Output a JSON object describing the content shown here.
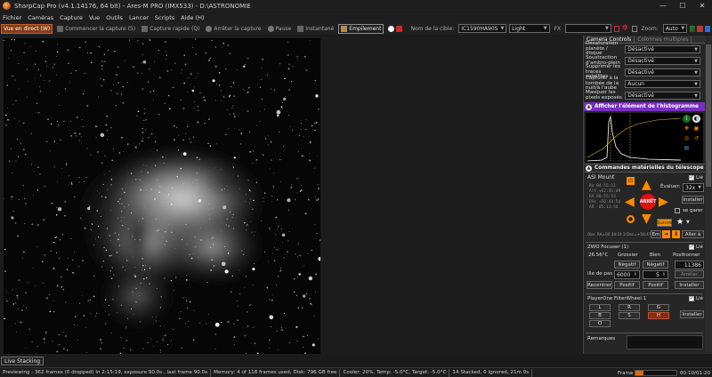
{
  "window": {
    "title": "SharpCap Pro (v4.1.14176, 64 bit) - Ares-M PRO (IMX533) - D:\\ASTRONOMIE",
    "minimize_icon": "minimize-icon",
    "maximize_icon": "maximize-icon",
    "close_icon": "close-icon"
  },
  "menu": [
    "Fichier",
    "Caméras",
    "Capture",
    "Vue",
    "Outils",
    "Lancer",
    "Scripts",
    "Aide (H)"
  ],
  "toolbar": {
    "live_view": "Vue en direct (W)",
    "start_capture": "Commencer la capture (5)",
    "quick_capture": "Capture rapide (Q)",
    "stop_capture": "Arrêter la capture",
    "pause": "Pause",
    "snapshot": "Instantané",
    "stacking": "Empilement",
    "target_label": "Nom de la cible:",
    "target_value": "IC1590HA90S",
    "filter_value": "Light",
    "fx_label": "FX",
    "fx_value": "",
    "zoom_label": "Zoom:",
    "zoom_value": "Auto"
  },
  "camera_controls": {
    "tab_active": "Camera Controls",
    "tab_inactive": "Colonnes multiples",
    "rows": [
      {
        "label": "Désaturation planète / disque",
        "value": "Désactivé"
      },
      {
        "label": "Soustraction d'ambro-plein",
        "value": "Désactivé"
      },
      {
        "label": "Supprimer les traces satellites",
        "value": "Désactivé"
      },
      {
        "label": "Capturer à la tombée de la nuit/à l'aube",
        "value": "Aucun"
      },
      {
        "label": "Masquer les pixels exposés",
        "value": "Désactivé"
      }
    ]
  },
  "histogram": {
    "header": "Afficher l'élément de l'histogramme"
  },
  "telescope": {
    "header": "Commandes matérielles du télescope",
    "mount_name": "ASI Mount",
    "enabled_label": "Lié",
    "rate_label": "Évaluer:",
    "rate_value": "32x",
    "install_label": "Installer",
    "stop_label": "ARRÊT",
    "park_label": "se garer",
    "follow_label": "Suivre",
    "goto_label": "Aller à",
    "em_label": "Em",
    "coords": [
      "Ra    04:55:11",
      "Alt   +62:41:09",
      "RA    00:55:53",
      "Déc  +56:44:54",
      "AR    -05:13:56"
    ],
    "sidereal": "Obs:  RA=00:34:24 2:Dec=+56:47:08"
  },
  "focuser": {
    "name": "ZWO Focuser (1)",
    "linked_label": "Lié",
    "temperature": "26.56°C",
    "coarse_label": "Grossier",
    "fine_label": "Bien",
    "position_label": "Positionner",
    "negative1": "Négatif",
    "negative2": "Négatif",
    "position_value": "11386",
    "step_label": "ille de pas",
    "step_coarse": "6000",
    "step_fine": "5",
    "stop_label": "Arrêter",
    "center_label": "Recentrer",
    "positive1": "Positif",
    "positive2": "Positif",
    "install_label": "Installer"
  },
  "filter_wheel": {
    "name": "PlayerOne FilterWheel 1",
    "linked_label": "Lié",
    "filters": [
      "L",
      "R",
      "G",
      "B",
      "S",
      "H",
      "O"
    ],
    "selected": "H",
    "install_label": "Installer"
  },
  "remarks_label": "Remarques",
  "live_stacking_tab": "Live Stacking",
  "status": {
    "preview": "Previewing : 362 frames (0 dropped) in 2:15:19, exposure 90.0s , last frame 90.0s",
    "memory": "Memory: 4 of 118 frames used, Disk: 796 GB free",
    "cooler": "Cooler: 20%, Temp: -5.0°C, Target: -5.0°C",
    "stacked": "14 Stacked, 0 Ignored, 21m 0s",
    "frame_label": "Frame",
    "frame_progress": 0.2,
    "time": "00:10/01:20"
  },
  "colors": {
    "accent_orange": "#ff8a00",
    "live_view_active": "#8a3b16",
    "histogram_header": "#7b2dbf",
    "stop_red": "#e01010",
    "filter_selected": "#8a2a10"
  }
}
